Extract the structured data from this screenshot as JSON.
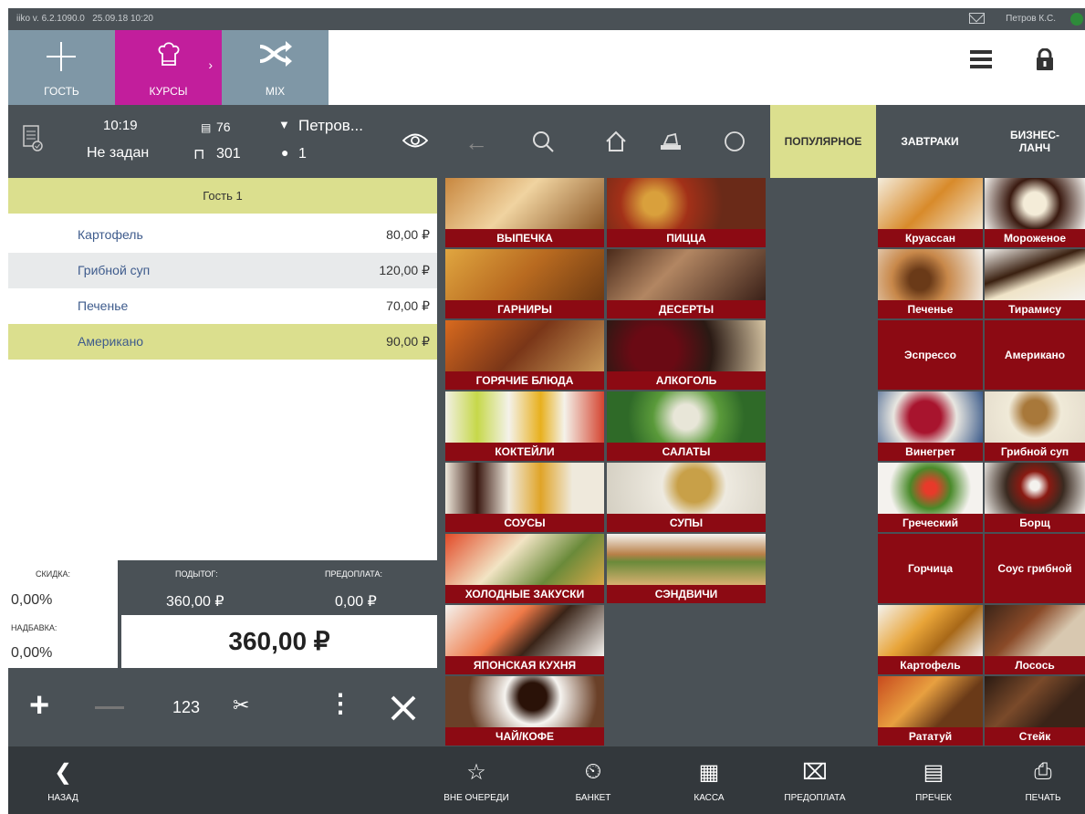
{
  "status": {
    "version": "iiko v. 6.2.1090.0",
    "date": "25.09.18",
    "time": "10:20",
    "user": "Петров К.С."
  },
  "topbar": {
    "guest_label": "ГОСТЬ",
    "courses_label": "КУРСЫ",
    "mix_label": "MIX"
  },
  "order": {
    "time": "10:19",
    "status": "Не задан",
    "order_no": "76",
    "table": "301",
    "waiter": "Петров...",
    "guests": "1",
    "guest_header": "Гость 1",
    "items": [
      {
        "name": "Картофель",
        "price": "80,00 ₽"
      },
      {
        "name": "Грибной суп",
        "price": "120,00 ₽"
      },
      {
        "name": "Печенье",
        "price": "70,00 ₽"
      },
      {
        "name": "Американо",
        "price": "90,00 ₽"
      }
    ]
  },
  "totals": {
    "discount_label": "СКИДКА:",
    "discount": "0,00%",
    "surcharge_label": "НАДБАВКА:",
    "surcharge": "0,00%",
    "subtotal_label": "ПОДЫТОГ:",
    "subtotal": "360,00 ₽",
    "prepay_label": "ПРЕДОПЛАТА:",
    "prepay": "0,00 ₽",
    "total": "360,00 ₽"
  },
  "actions": {
    "qty_label": "123"
  },
  "cat_tabs": [
    "ПОПУЛЯРНОЕ",
    "ЗАВТРАКИ",
    "БИЗНЕС-\nЛАНЧ"
  ],
  "categories": [
    "ВЫПЕЧКА",
    "ПИЦЦА",
    "ГАРНИРЫ",
    "ДЕСЕРТЫ",
    "ГОРЯЧИЕ БЛЮДА",
    "АЛКОГОЛЬ",
    "КОКТЕЙЛИ",
    "САЛАТЫ",
    "СОУСЫ",
    "СУПЫ",
    "ХОЛОДНЫЕ ЗАКУСКИ",
    "СЭНДВИЧИ",
    "ЯПОНСКАЯ КУХНЯ",
    "ЧАЙ/КОФЕ"
  ],
  "products": [
    "Круассан",
    "Мороженое",
    "Печенье",
    "Тирамису",
    "Эспрессо",
    "Американо",
    "Винегрет",
    "Грибной суп",
    "Греческий",
    "Борщ",
    "Горчица",
    "Соус грибной",
    "Картофель",
    "Лосось",
    "Рататуй",
    "Стейк"
  ],
  "bottom": {
    "back": "НАЗАД",
    "out_of_turn": "ВНЕ ОЧЕРЕДИ",
    "banquet": "БАНКЕТ",
    "cash": "КАССА",
    "prepay": "ПРЕДОПЛАТА",
    "precheck": "ПРЕЧЕК",
    "print": "ПЕЧАТЬ"
  },
  "colors": {
    "accent_courses": "#c21e9c",
    "tab_active": "#dbdf8e",
    "tile_red": "#8c0a13",
    "panel": "#4a5156"
  }
}
